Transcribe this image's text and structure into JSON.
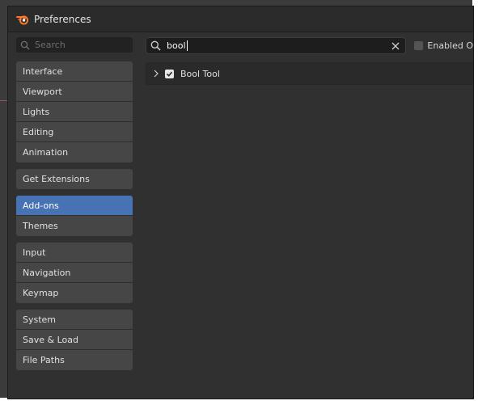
{
  "window": {
    "title": "Preferences",
    "app_icon": "blender-icon"
  },
  "sidebar": {
    "search_placeholder": "Search",
    "groups": [
      {
        "items": [
          "Interface",
          "Viewport",
          "Lights",
          "Editing",
          "Animation"
        ]
      },
      {
        "items": [
          "Get Extensions"
        ]
      },
      {
        "items": [
          "Add-ons",
          "Themes"
        ]
      },
      {
        "items": [
          "Input",
          "Navigation",
          "Keymap"
        ]
      },
      {
        "items": [
          "System",
          "Save & Load",
          "File Paths"
        ]
      }
    ],
    "active_item": "Add-ons"
  },
  "main": {
    "search_value": "bool",
    "enabled_only_label": "Enabled O",
    "enabled_only_checked": false,
    "addons": [
      {
        "name": "Bool Tool",
        "enabled": true,
        "expanded": false
      }
    ]
  },
  "colors": {
    "accent": "#4772b3",
    "window_bg": "#303030",
    "item_bg": "#464646"
  }
}
